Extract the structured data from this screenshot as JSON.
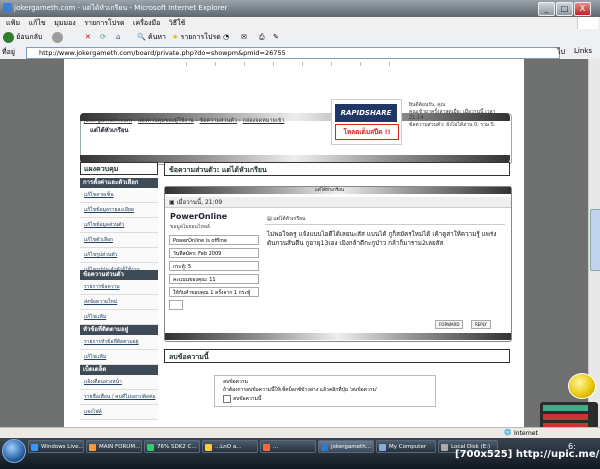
{
  "window": {
    "title": "jokergameth.com - แต่ได้หัวเกรียน - Microsoft Internet Explorer",
    "controls": [
      "_",
      "□",
      "X"
    ]
  },
  "menu": [
    "แฟ้ม",
    "แก้ไข",
    "มุมมอง",
    "รายการโปรด",
    "เครื่องมือ",
    "วิธีใช้"
  ],
  "toolbar": {
    "back": "ย้อนกลับ",
    "search": "ค้นหา",
    "favorites": "รายการโปรด"
  },
  "address": {
    "label": "ที่อยู่",
    "url": "http://www.jokergameth.com/board/private.php?do=showpm&pmid=26755",
    "go": "ไป",
    "links": "Links"
  },
  "header": {
    "crumb_site": "jokergameth.com",
    "crumb_sep1": "›",
    "crumb_cp": "แผงควบคุมของผู้ใช้งาน",
    "crumb_sep2": "›",
    "crumb_pm": "ข้อความส่วนตัว",
    "crumb_sep3": "›",
    "crumb_inbox": "กล่องจดหมายเข้า",
    "page_title": "แต่ได้หัวเกรียน",
    "banner_top": "RAPIDSHARE",
    "banner_bottom": "โหลดเต็มสปีด !!",
    "welcome_lines": [
      "ยินดีต้อนรับ, คุณ",
      "คุณเข้ามาครั้งล่าสุดเมื่อ: เมื่อวานนี้ เวลา 21:14",
      "ข้อความส่วนตัว: ยังไม่ได้อ่าน 0, รวม 5."
    ]
  },
  "sidebar": {
    "title": "แผงควบคุม",
    "sections": [
      {
        "title": "การตั้งค่าและตัวเลือก",
        "items": [
          "แก้ไขลายเซ็น",
          "แก้ไขข้อมูลรายละเอียด",
          "แก้ไขข้อมูลส่วนตัว",
          "แก้ไขตัวเลือก",
          "แก้ไขรูปส่วนตัว",
          "แก้ไขรูปประจำตัวผู้ใช้งาน"
        ]
      },
      {
        "title": "ข้อความส่วนตัว",
        "items": [
          "รายการข้อความ",
          "ส่งข้อความใหม่",
          "แก้ไขแฟ้ม"
        ]
      },
      {
        "title": "หัวข้อที่ติดตามอยู่",
        "items": [
          "รายการหัวข้อที่ติดตามอยู่",
          "แก้ไขแฟ้ม"
        ]
      },
      {
        "title": "เบ็ดเตล็ด",
        "items": [
          "แจ้งเตือนล่วงหน้า",
          "รายชื่อเพื่อน / คนที่ไม่อยากติดต่อ",
          "แจงไฟล์"
        ]
      }
    ]
  },
  "pm": {
    "section_title": "ข้อความส่วนตัว: แต่ได้หัวเกรียน",
    "box_title": "แต่ได้หัวเกรียน",
    "date": "เมื่อวานนี้, 21:09",
    "username": "PowerOnline",
    "usertitle": "ขอมูลไมยอนไหลล์",
    "status": "PowerOnline is offline",
    "joined": "วันที่สมัคร: Feb 2009",
    "posts": "กระทู้: 5",
    "points": "คะแนนของคุณ: 11",
    "rep": "ให้กับคำขอบคุณ 1 ครั้งจาก 1 กระทู้",
    "msg_title": "แต่ได้หัวเกรียน",
    "message": "ไม่พอใจครู แจ้งแบบไอดีได้เลยนะสัส แบนได้ กูก็สมัครใหม่ได้ เค้าดูสาให้ความรู้ แพร่งดันกวนส้นตีน กูอายุ13เอง เมิงกล้าตีกะกูป่าว กล้าก็มาราม2เลยสัส",
    "btn_forward": "FORWARD",
    "btn_reply": "REPLY",
    "delete_title": "ลบข้อความนี้",
    "delete_legend": "ลบข้อความ",
    "delete_text": "ถ้าต้องการลบข้อความนี้ให้เช็คบ็อกซ์ข้างล่าง แล้วคลิกที่ปุ่ม 'ลบข้อความ'",
    "delete_checkbox": "ลบข้อความนี้"
  },
  "status": {
    "zone": "Internet"
  },
  "taskbar": {
    "items": [
      "Windows Live...",
      "MAIN FORUM...",
      "76% SDK2 C...",
      "...LnO a...",
      "...",
      "jokergameth...",
      "My Computer",
      "Local Disk (E:)"
    ],
    "time": "6:"
  },
  "watermark": "[700x525] http://upic.me/"
}
